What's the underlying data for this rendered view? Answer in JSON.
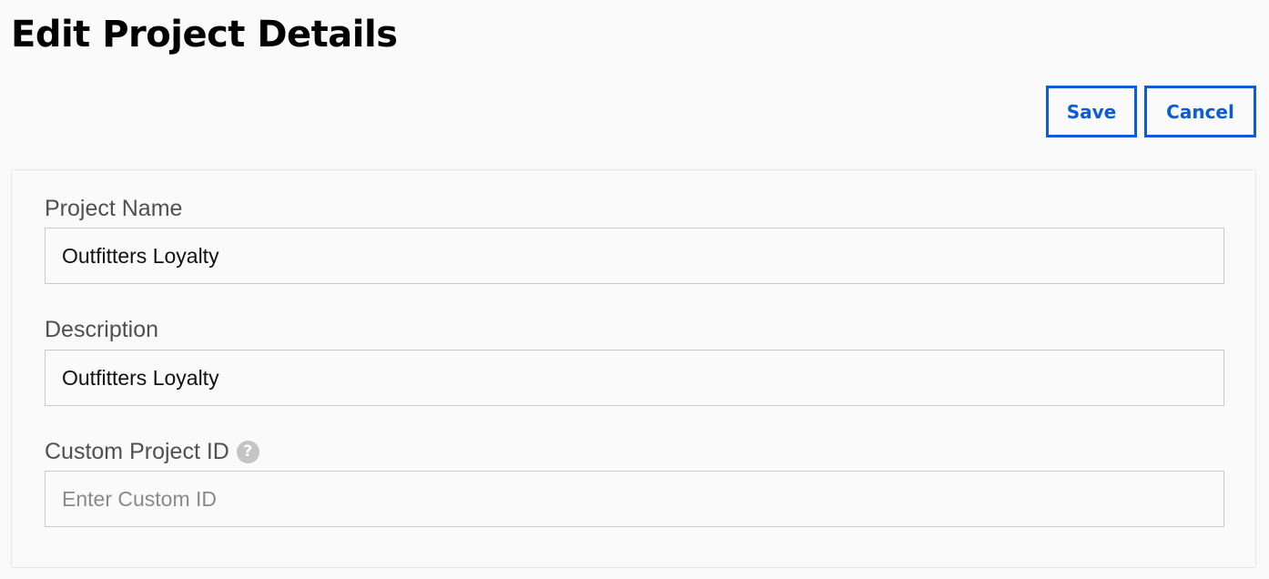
{
  "page": {
    "title": "Edit Project Details"
  },
  "actions": {
    "save_label": "Save",
    "cancel_label": "Cancel"
  },
  "form": {
    "project_name": {
      "label": "Project Name",
      "value": "Outfitters Loyalty"
    },
    "description": {
      "label": "Description",
      "value": "Outfitters Loyalty"
    },
    "custom_id": {
      "label": "Custom Project ID",
      "value": "",
      "placeholder": "Enter Custom ID",
      "help_icon": "?"
    }
  },
  "colors": {
    "accent": "#0b5cd6",
    "background": "#fafafa",
    "border": "#c9c9c9"
  }
}
